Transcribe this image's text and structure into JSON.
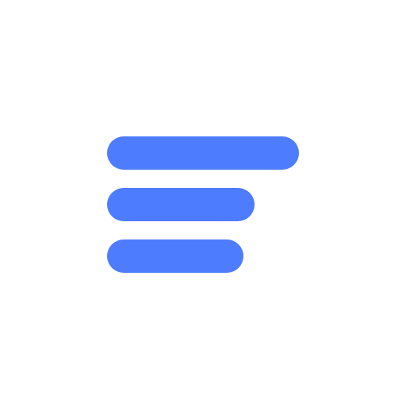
{
  "icon": {
    "name": "hamburger-menu-icon",
    "color": "#4d7cfe",
    "background": "#ffffff",
    "bars": [
      "top-bar",
      "middle-bar",
      "bottom-bar"
    ]
  }
}
